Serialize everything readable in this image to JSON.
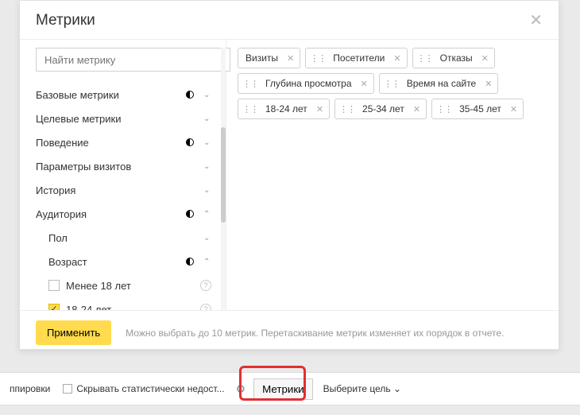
{
  "modal": {
    "title": "Метрики",
    "search_placeholder": "Найти метрику",
    "apply_label": "Применить",
    "hint": "Можно выбрать до 10 метрик. Перетаскивание метрик изменяет их порядок в отчете."
  },
  "categories": [
    {
      "label": "Базовые метрики",
      "indicator": "half",
      "open": false
    },
    {
      "label": "Целевые метрики",
      "indicator": "",
      "open": false
    },
    {
      "label": "Поведение",
      "indicator": "half",
      "open": false
    },
    {
      "label": "Параметры визитов",
      "indicator": "",
      "open": false
    },
    {
      "label": "История",
      "indicator": "",
      "open": false
    },
    {
      "label": "Аудитория",
      "indicator": "half",
      "open": true
    }
  ],
  "audience_sub": [
    {
      "label": "Пол",
      "indicator": "",
      "open": false
    },
    {
      "label": "Возраст",
      "indicator": "half",
      "open": true
    }
  ],
  "age_items": [
    {
      "label": "Менее 18 лет",
      "checked": false
    },
    {
      "label": "18-24 лет",
      "checked": true
    }
  ],
  "chips_row1": [
    {
      "label": "Визиты",
      "grip": false
    },
    {
      "label": "Посетители",
      "grip": true
    },
    {
      "label": "Отказы",
      "grip": true
    }
  ],
  "chips_row2": [
    {
      "label": "Глубина просмотра",
      "grip": true
    },
    {
      "label": "Время на сайте",
      "grip": true
    }
  ],
  "chips_row3": [
    {
      "label": "18-24 лет",
      "grip": true
    },
    {
      "label": "25-34 лет",
      "grip": true
    },
    {
      "label": "35-45 лет",
      "grip": true
    }
  ],
  "bottom": {
    "group_label": "ппировки",
    "hide_stat_label": "Скрывать статистически недост...",
    "metrics_btn": "Метрики",
    "choose_goal": "Выберите цель"
  }
}
